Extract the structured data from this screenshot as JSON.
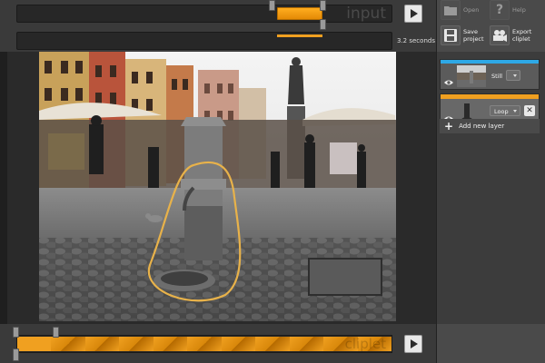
{
  "input_track": {
    "watermark": "input",
    "selection_start": 0.69,
    "selection_end": 0.81
  },
  "duration": {
    "label": "3.2 seconds"
  },
  "clip_track": {
    "watermark": "cliplet",
    "segments": 11
  },
  "toolbar": {
    "open": "Open",
    "help": "Help",
    "save_line1": "Save",
    "save_line2": "project",
    "export_line1": "Export",
    "export_line2": "cliplet"
  },
  "layers": [
    {
      "mode": "Still",
      "accent": "#2ea8e6"
    },
    {
      "mode": "Loop",
      "accent": "#f0a020"
    }
  ],
  "add_layer": "Add new layer",
  "colors": {
    "accent": "#f0a020",
    "panel": "#4a4a4a",
    "track": "#272727"
  },
  "icons": {
    "open": "folder-icon",
    "help": "question-icon",
    "save": "floppy-disk-icon",
    "export": "film-reel-icon",
    "visibility": "eye-icon",
    "delete": "close-icon",
    "add": "plus-icon",
    "play": "play-icon"
  }
}
